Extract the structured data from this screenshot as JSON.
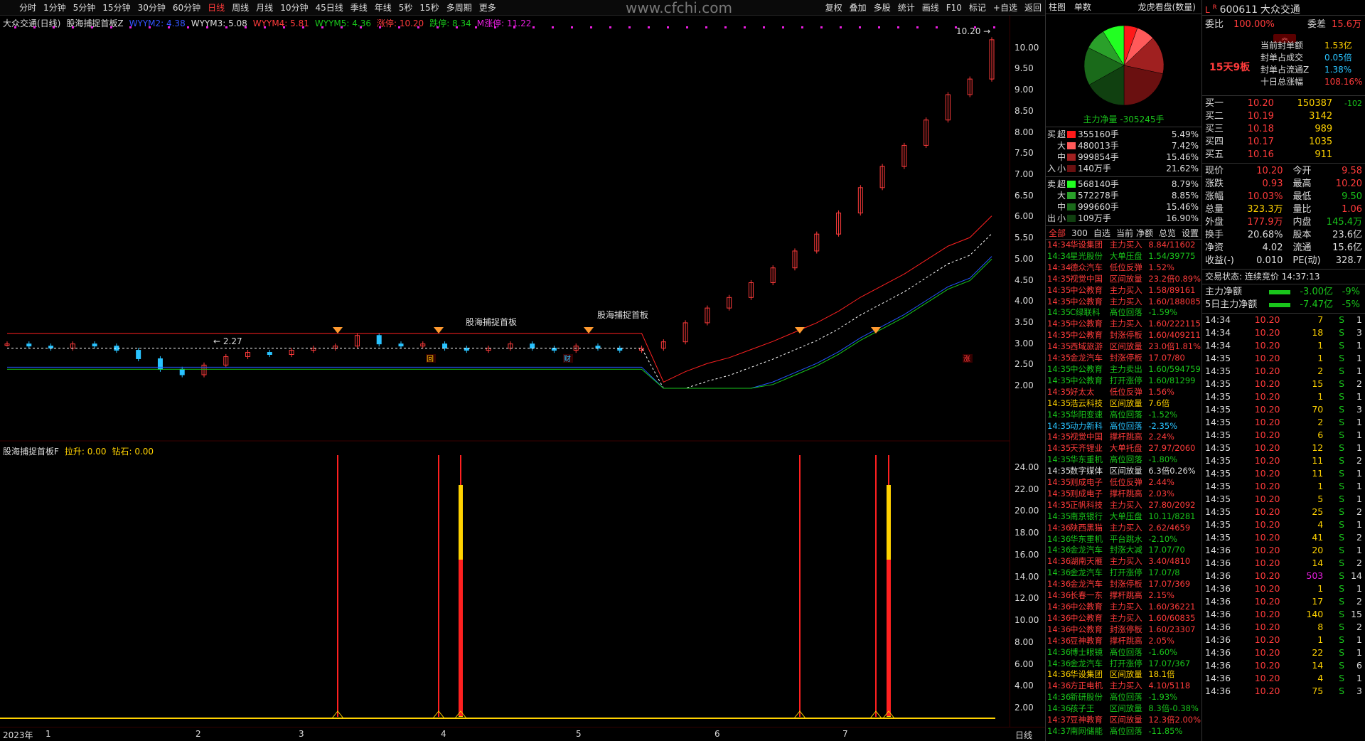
{
  "toolbar": {
    "left": [
      "分时",
      "1分钟",
      "5分钟",
      "15分钟",
      "30分钟",
      "60分钟",
      "日线",
      "周线",
      "月线",
      "10分钟",
      "45日线",
      "季线",
      "年线",
      "5秒",
      "15秒",
      "多周期",
      "更多"
    ],
    "active": "日线",
    "right": [
      "复权",
      "叠加",
      "多股",
      "统计",
      "画线",
      "F10",
      "标记",
      "+自选",
      "返回"
    ]
  },
  "watermark": "www.cfchi.com",
  "main_legend": [
    {
      "t": "大众交通(日线)",
      "c": "#ddd"
    },
    {
      "t": "股海捕捉首板Z",
      "c": "#ddd"
    },
    {
      "t": "WYYM2: 4.38",
      "c": "#3355ff"
    },
    {
      "t": "WYYM3: 5.08",
      "c": "#ddd"
    },
    {
      "t": "WYYM4: 5.81",
      "c": "#ff3b3b"
    },
    {
      "t": "WYYM5: 4.36",
      "c": "#19c51b"
    },
    {
      "t": "涨停: 10.20",
      "c": "#ff3b3b"
    },
    {
      "t": "跌停: 8.34",
      "c": "#19c51b"
    },
    {
      "t": "M涨停: 11.22",
      "c": "#e91ee0"
    }
  ],
  "sub_legend": [
    {
      "t": "股海捕捉首板F",
      "c": "#ddd"
    },
    {
      "t": "拉升: 0.00",
      "c": "#ffd200"
    },
    {
      "t": "钻石: 0.00",
      "c": "#ffd200"
    }
  ],
  "axis_labels": [
    "10.00",
    "9.50",
    "9.00",
    "8.50",
    "8.00",
    "7.50",
    "7.00",
    "6.50",
    "6.00",
    "5.50",
    "5.00",
    "4.50",
    "4.00",
    "3.50",
    "3.00",
    "2.50",
    "2.00"
  ],
  "sub_axis_labels": [
    "24.00",
    "22.00",
    "20.00",
    "18.00",
    "16.00",
    "14.00",
    "12.00",
    "10.00",
    "8.00",
    "6.00",
    "4.00",
    "2.00"
  ],
  "annotations": {
    "high": "10.20",
    "low": "2.27",
    "indicator_label": "股海捕捉首板",
    "markers": [
      "回",
      "财",
      "涨"
    ]
  },
  "date_axis": [
    "2023年",
    "1",
    "2",
    "3",
    "4",
    "5",
    "6",
    "7"
  ],
  "date_axis_right": "日线",
  "chart_data": {
    "type": "candlestick",
    "ylim": [
      1.9,
      10.4
    ],
    "close_approx": [
      3.0,
      2.95,
      2.9,
      3.0,
      2.95,
      2.85,
      2.65,
      2.4,
      2.27,
      2.5,
      2.7,
      2.8,
      2.75,
      2.85,
      2.9,
      2.95,
      3.2,
      3.0,
      2.95,
      3.0,
      2.9,
      2.85,
      2.9,
      3.0,
      2.9,
      2.85,
      2.95,
      2.9,
      2.85,
      2.9,
      3.05,
      3.5,
      3.85,
      4.1,
      4.45,
      4.8,
      5.2,
      5.6,
      6.1,
      6.7,
      7.2,
      7.7,
      8.3,
      8.9,
      9.27,
      10.2
    ]
  },
  "rp": {
    "tabs": [
      "柱图",
      "单数"
    ],
    "title": "龙虎看盘(数量)",
    "net": "主力净量 -305245手",
    "buy": [
      {
        "k": "超",
        "v": "355160手",
        "p": "5.49%"
      },
      {
        "k": "大",
        "v": "480013手",
        "p": "7.42%"
      },
      {
        "k": "中",
        "v": "999854手",
        "p": "15.46%"
      },
      {
        "k": "小",
        "v": "140万手",
        "p": "21.62%"
      }
    ],
    "sell": [
      {
        "k": "超",
        "v": "568140手",
        "p": "8.79%"
      },
      {
        "k": "大",
        "v": "572278手",
        "p": "8.85%"
      },
      {
        "k": "中",
        "v": "999660手",
        "p": "15.46%"
      },
      {
        "k": "小",
        "v": "109万手",
        "p": "16.90%"
      }
    ],
    "buy_side": [
      "买",
      "入"
    ],
    "sell_side": [
      "卖",
      "出"
    ],
    "filters": [
      "全部",
      "300",
      "自选",
      "当前"
    ],
    "filters_r": [
      "净额",
      "总览",
      "设置"
    ],
    "feed": [
      [
        "14:34",
        "华设集团",
        "主力买入",
        "8.84/11602",
        "r"
      ],
      [
        "14:34",
        "星光股份",
        "大单压盘",
        "1.54/39775",
        "g"
      ],
      [
        "14:34",
        "德众汽车",
        "低位反弹",
        "1.52%",
        "r"
      ],
      [
        "14:35",
        "视觉中国",
        "区间放量",
        "23.2倍0.89%",
        "r"
      ],
      [
        "14:35",
        "中公教育",
        "主力买入",
        "1.58/89161",
        "r"
      ],
      [
        "14:35",
        "中公教育",
        "主力买入",
        "1.60/188085",
        "r"
      ],
      [
        "14:35",
        "C绿联科",
        "高位回落",
        "-1.59%",
        "g"
      ],
      [
        "14:35",
        "中公教育",
        "主力买入",
        "1.60/222115",
        "r"
      ],
      [
        "14:35",
        "中公教育",
        "封涨停板",
        "1.60/409211",
        "r"
      ],
      [
        "14:35",
        "西域旅游",
        "区间放量",
        "23.0倍1.81%",
        "r"
      ],
      [
        "14:35",
        "金龙汽车",
        "封涨停板",
        "17.07/80",
        "r"
      ],
      [
        "14:35",
        "中公教育",
        "主力卖出",
        "1.60/594759",
        "g"
      ],
      [
        "14:35",
        "中公教育",
        "打开涨停",
        "1.60/81299",
        "g"
      ],
      [
        "14:35",
        "好太太",
        "低位反弹",
        "1.56%",
        "r"
      ],
      [
        "14:35",
        "浩云科技",
        "区间放量",
        "7.6倍",
        "y"
      ],
      [
        "14:35",
        "华阳变速",
        "高位回落",
        "-1.52%",
        "g"
      ],
      [
        "14:35",
        "动力新科",
        "高位回落",
        "-2.35%",
        "c"
      ],
      [
        "14:35",
        "视觉中国",
        "撑杆跳高",
        "2.24%",
        "r"
      ],
      [
        "14:35",
        "天齐锂业",
        "大单托盘",
        "27.97/2060",
        "r"
      ],
      [
        "14:35",
        "华东重机",
        "高位回落",
        "-1.80%",
        "g"
      ],
      [
        "14:35",
        "数字媒体",
        "区间放量",
        "6.3倍0.26%",
        "w"
      ],
      [
        "14:35",
        "则成电子",
        "低位反弹",
        "2.44%",
        "r"
      ],
      [
        "14:35",
        "则成电子",
        "撑杆跳高",
        "2.03%",
        "r"
      ],
      [
        "14:35",
        "正帆科技",
        "主力买入",
        "27.80/2092",
        "r"
      ],
      [
        "14:35",
        "南京银行",
        "大单压盘",
        "10.11/8281",
        "g"
      ],
      [
        "14:36",
        "陕西黑猫",
        "主力买入",
        "2.62/4659",
        "r"
      ],
      [
        "14:36",
        "华东重机",
        "平台跳水",
        "-2.10%",
        "g"
      ],
      [
        "14:36",
        "金龙汽车",
        "封涨大减",
        "17.07/70",
        "g"
      ],
      [
        "14:36",
        "湖南天雁",
        "主力买入",
        "3.40/4810",
        "r"
      ],
      [
        "14:36",
        "金龙汽车",
        "打开涨停",
        "17.07/8",
        "g"
      ],
      [
        "14:36",
        "金龙汽车",
        "封涨停板",
        "17.07/369",
        "r"
      ],
      [
        "14:36",
        "长春一东",
        "撑杆跳高",
        "2.15%",
        "r"
      ],
      [
        "14:36",
        "中公教育",
        "主力买入",
        "1.60/36221",
        "r"
      ],
      [
        "14:36",
        "中公教育",
        "主力买入",
        "1.60/60835",
        "r"
      ],
      [
        "14:36",
        "中公教育",
        "封涨停板",
        "1.60/23307",
        "r"
      ],
      [
        "14:36",
        "豆神教育",
        "撑杆跳高",
        "2.05%",
        "r"
      ],
      [
        "14:36",
        "博士眼镜",
        "高位回落",
        "-1.60%",
        "g"
      ],
      [
        "14:36",
        "金龙汽车",
        "打开涨停",
        "17.07/367",
        "g"
      ],
      [
        "14:36",
        "华设集团",
        "区间放量",
        "18.1倍",
        "y"
      ],
      [
        "14:36",
        "方正电机",
        "主力买入",
        "4.10/5118",
        "r"
      ],
      [
        "14:36",
        "新研股份",
        "高位回落",
        "-1.93%",
        "g"
      ],
      [
        "14:36",
        "孩子王",
        "区间放量",
        "8.3倍-0.38%",
        "g"
      ],
      [
        "14:37",
        "豆神教育",
        "区间放量",
        "12.3倍2.00%",
        "r"
      ],
      [
        "14:37",
        "南网储能",
        "高位回落",
        "-11.85%",
        "g"
      ]
    ]
  },
  "qp": {
    "code": "600611",
    "name": "大众交通",
    "L": "L",
    "R": "R",
    "webi_k": "委比",
    "webi_v": "100.00%",
    "weicha_k": "委差",
    "weicha_v": "15.6万",
    "board": "15天9板",
    "seal": [
      {
        "k": "当前封单额",
        "v": "1.53亿"
      },
      {
        "k": "封单占成交",
        "v": "0.05倍"
      },
      {
        "k": "封单占流通Z",
        "v": "1.38%"
      },
      {
        "k": "十日总涨幅",
        "v": "108.16%"
      }
    ],
    "bids": [
      [
        "买一",
        "10.20",
        "150387",
        "-102"
      ],
      [
        "买二",
        "10.19",
        "3142",
        ""
      ],
      [
        "买三",
        "10.18",
        "989",
        ""
      ],
      [
        "买四",
        "10.17",
        "1035",
        ""
      ],
      [
        "买五",
        "10.16",
        "911",
        ""
      ]
    ],
    "stats": [
      [
        "现价",
        "10.20",
        "今开",
        "9.58"
      ],
      [
        "涨跌",
        "0.93",
        "最高",
        "10.20"
      ],
      [
        "涨幅",
        "10.03%",
        "最低",
        "9.50"
      ],
      [
        "总量",
        "323.3万",
        "量比",
        "1.06"
      ],
      [
        "外盘",
        "177.9万",
        "内盘",
        "145.4万"
      ],
      [
        "换手",
        "20.68%",
        "股本",
        "23.6亿"
      ],
      [
        "净资",
        "4.02",
        "流通",
        "15.6亿"
      ],
      [
        "收益(-)",
        "0.010",
        "PE(动)",
        "328.7"
      ]
    ],
    "status": "交易状态: 连续竞价 14:37:13",
    "flow": [
      [
        "主力净额",
        "-3.00亿",
        "-9%"
      ],
      [
        "5日主力净额",
        "-7.47亿",
        "-5%"
      ]
    ],
    "ticks": [
      [
        "14:34",
        "10.20",
        "7",
        "S",
        "1"
      ],
      [
        "14:34",
        "10.20",
        "18",
        "S",
        "3"
      ],
      [
        "14:34",
        "10.20",
        "1",
        "S",
        "1"
      ],
      [
        "14:35",
        "10.20",
        "1",
        "S",
        "1"
      ],
      [
        "14:35",
        "10.20",
        "2",
        "S",
        "1"
      ],
      [
        "14:35",
        "10.20",
        "15",
        "S",
        "2"
      ],
      [
        "14:35",
        "10.20",
        "1",
        "S",
        "1"
      ],
      [
        "14:35",
        "10.20",
        "70",
        "S",
        "3"
      ],
      [
        "14:35",
        "10.20",
        "2",
        "S",
        "1"
      ],
      [
        "14:35",
        "10.20",
        "6",
        "S",
        "1"
      ],
      [
        "14:35",
        "10.20",
        "12",
        "S",
        "1"
      ],
      [
        "14:35",
        "10.20",
        "11",
        "S",
        "2"
      ],
      [
        "14:35",
        "10.20",
        "11",
        "S",
        "1"
      ],
      [
        "14:35",
        "10.20",
        "1",
        "S",
        "1"
      ],
      [
        "14:35",
        "10.20",
        "5",
        "S",
        "1"
      ],
      [
        "14:35",
        "10.20",
        "25",
        "S",
        "2"
      ],
      [
        "14:35",
        "10.20",
        "4",
        "S",
        "1"
      ],
      [
        "14:35",
        "10.20",
        "41",
        "S",
        "2"
      ],
      [
        "14:36",
        "10.20",
        "20",
        "S",
        "1"
      ],
      [
        "14:36",
        "10.20",
        "14",
        "S",
        "2"
      ],
      [
        "14:36",
        "10.20",
        "503",
        "S",
        "14"
      ],
      [
        "14:36",
        "10.20",
        "1",
        "S",
        "1"
      ],
      [
        "14:36",
        "10.20",
        "17",
        "S",
        "2"
      ],
      [
        "14:36",
        "10.20",
        "140",
        "S",
        "15"
      ],
      [
        "14:36",
        "10.20",
        "8",
        "S",
        "2"
      ],
      [
        "14:36",
        "10.20",
        "1",
        "S",
        "1"
      ],
      [
        "14:36",
        "10.20",
        "22",
        "S",
        "1"
      ],
      [
        "14:36",
        "10.20",
        "14",
        "S",
        "6"
      ],
      [
        "14:36",
        "10.20",
        "4",
        "S",
        "1"
      ],
      [
        "14:36",
        "10.20",
        "75",
        "S",
        "3"
      ]
    ]
  }
}
